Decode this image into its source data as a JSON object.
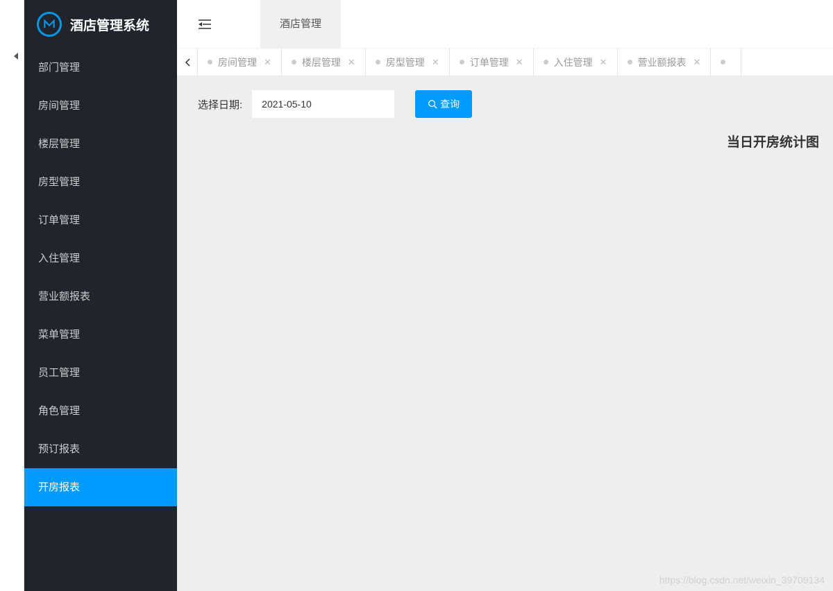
{
  "app": {
    "title": "酒店管理系统"
  },
  "sidebar": {
    "items": [
      {
        "label": "部门管理",
        "active": false
      },
      {
        "label": "房间管理",
        "active": false
      },
      {
        "label": "楼层管理",
        "active": false
      },
      {
        "label": "房型管理",
        "active": false
      },
      {
        "label": "订单管理",
        "active": false
      },
      {
        "label": "入住管理",
        "active": false
      },
      {
        "label": "营业额报表",
        "active": false
      },
      {
        "label": "菜单管理",
        "active": false
      },
      {
        "label": "员工管理",
        "active": false
      },
      {
        "label": "角色管理",
        "active": false
      },
      {
        "label": "预订报表",
        "active": false
      },
      {
        "label": "开房报表",
        "active": true
      }
    ]
  },
  "topbar": {
    "active_tab": "酒店管理"
  },
  "tabs": [
    {
      "label": "房间管理"
    },
    {
      "label": "楼层管理"
    },
    {
      "label": "房型管理"
    },
    {
      "label": "订单管理"
    },
    {
      "label": "入住管理"
    },
    {
      "label": "营业额报表"
    },
    {
      "label": ""
    }
  ],
  "filter": {
    "label": "选择日期:",
    "date_value": "2021-05-10",
    "search_label": "查询"
  },
  "chart": {
    "title": "当日开房统计图"
  },
  "watermark": "https://blog.csdn.net/weixin_39709134"
}
